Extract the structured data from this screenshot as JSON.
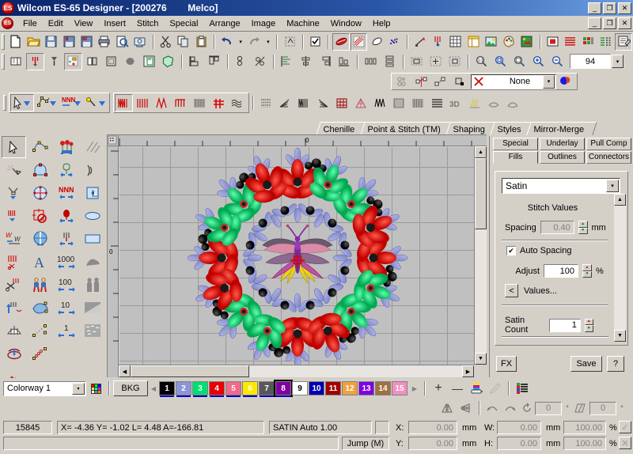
{
  "window": {
    "title": "Wilcom ES-65 Designer - [200276        Melco]",
    "app_icon": "ES",
    "minimize": "_",
    "maximize": "❐",
    "close": "✕"
  },
  "menu": {
    "items": [
      "File",
      "Edit",
      "View",
      "Insert",
      "Stitch",
      "Special",
      "Arrange",
      "Image",
      "Machine",
      "Window",
      "Help"
    ],
    "doc_minimize": "_",
    "doc_maximize": "❐",
    "doc_close": "✕"
  },
  "toolbars": {
    "standard": [
      {
        "name": "new-icon",
        "glyph": "📄"
      },
      {
        "name": "open-icon",
        "glyph": "📂"
      },
      {
        "name": "save-icon",
        "glyph": "💾"
      },
      {
        "name": "save-stitch-icon",
        "glyph": "🖫"
      },
      {
        "name": "save-machine-icon",
        "glyph": "🖬"
      },
      {
        "name": "print-icon",
        "glyph": "🖨"
      },
      {
        "name": "print-preview-icon",
        "glyph": "🔎"
      },
      {
        "name": "send-to-machine-icon",
        "glyph": "🖳"
      },
      {
        "name": "cut-icon",
        "glyph": "✂"
      },
      {
        "name": "copy-icon",
        "glyph": "⧉"
      },
      {
        "name": "paste-icon",
        "glyph": "📋"
      },
      {
        "name": "undo-icon",
        "glyph": "↩"
      },
      {
        "name": "undo-dropdown-icon",
        "glyph": "▾"
      },
      {
        "name": "redo-icon",
        "glyph": "↪"
      },
      {
        "name": "redo-dropdown-icon",
        "glyph": "▾"
      },
      {
        "name": "reshape-icon",
        "glyph": "⌗"
      },
      {
        "name": "select-check-icon",
        "glyph": "☑"
      },
      {
        "name": "stitch-view-icon",
        "glyph": "🌶"
      },
      {
        "name": "needle-points-icon",
        "glyph": "▧"
      },
      {
        "name": "outline-view-icon",
        "glyph": "◌"
      },
      {
        "name": "connectors-view-icon",
        "glyph": "⁘"
      },
      {
        "name": "measure-icon",
        "glyph": "⤢"
      },
      {
        "name": "stitch-player-icon",
        "glyph": "⇟"
      },
      {
        "name": "grid-icon",
        "glyph": "▦"
      },
      {
        "name": "hoop-icon",
        "glyph": "▤"
      },
      {
        "name": "backdrop-icon",
        "glyph": "🏞"
      },
      {
        "name": "color-palette-icon",
        "glyph": "🎨"
      },
      {
        "name": "bitmap-icon",
        "glyph": "🖼"
      },
      {
        "name": "thumbnail-icon",
        "glyph": "▣"
      },
      {
        "name": "stitch-list-icon",
        "glyph": "≣"
      },
      {
        "name": "color-film-icon",
        "glyph": "▥"
      },
      {
        "name": "object-props-icon",
        "glyph": "▩"
      },
      {
        "name": "design-props-icon",
        "glyph": "🗒"
      }
    ],
    "view_row": [
      {
        "name": "align-left-icon",
        "glyph": "⫞"
      },
      {
        "name": "align-center-icon",
        "glyph": "⫟"
      },
      {
        "name": "align-right-icon",
        "glyph": "⫠"
      },
      {
        "name": "distribute-h-icon",
        "glyph": "⫝"
      },
      {
        "name": "distribute-v-icon",
        "glyph": "⩸"
      },
      {
        "name": "group-icon",
        "glyph": "⊞"
      },
      {
        "name": "ungroup-icon",
        "glyph": "⊟"
      },
      {
        "name": "lock-icon",
        "glyph": "⊠"
      },
      {
        "name": "zoom-11-icon",
        "glyph": "🔍"
      },
      {
        "name": "zoom-in-box-icon",
        "glyph": "🔍"
      },
      {
        "name": "zoom-to-fit-icon",
        "glyph": "🔍"
      },
      {
        "name": "zoom-in-icon",
        "glyph": "🔍"
      },
      {
        "name": "zoom-out-icon",
        "glyph": "🔍"
      }
    ],
    "zoom_value": "94",
    "zoom_dropdown": "▾"
  },
  "connector_bar": {
    "icons": [
      {
        "name": "auto-start-end-icon",
        "glyph": "◌"
      },
      {
        "name": "connector-type-icon",
        "glyph": "◈"
      },
      {
        "name": "entry-point-icon",
        "glyph": "◇"
      },
      {
        "name": "exit-point-icon",
        "glyph": "◆"
      }
    ],
    "selected_value": "None",
    "dropdown_glyph": "▾",
    "color_icon": "color-wheel-icon"
  },
  "mode_bar": {
    "left_groups": [
      {
        "name": "select-object-icon",
        "glyph": "➤",
        "dropdown": true
      },
      {
        "name": "reshape-object-icon",
        "glyph": "⬡",
        "dropdown": true
      },
      {
        "name": "stitch-edit-icon",
        "glyph": "NNN",
        "dropdown": true
      },
      {
        "name": "digitize-icon",
        "glyph": "✎",
        "dropdown": true
      }
    ],
    "stitch_types": [
      {
        "name": "satin-stitch-icon",
        "glyph": "ΜΜ"
      },
      {
        "name": "step-stitch-icon",
        "glyph": "ΙΙΙ"
      },
      {
        "name": "zigzag-stitch-icon",
        "glyph": "ΛΛ"
      },
      {
        "name": "e-stitch-icon",
        "glyph": "ΠΠ"
      },
      {
        "name": "tatami-fill-icon",
        "glyph": "▦"
      },
      {
        "name": "cross-stitch-icon",
        "glyph": "✚"
      },
      {
        "name": "motif-run-icon",
        "glyph": "≋"
      },
      {
        "name": "contour-fill-icon",
        "glyph": "⁞⁞"
      },
      {
        "name": "radial-fill-icon",
        "glyph": "⋙"
      },
      {
        "name": "spiral-fill-icon",
        "glyph": "ΜΜ"
      },
      {
        "name": "florentine-fill-icon",
        "glyph": "⋘"
      },
      {
        "name": "carving-stamp-icon",
        "glyph": "⊞"
      },
      {
        "name": "pattern-stamp-icon",
        "glyph": "◬"
      },
      {
        "name": "jagged-edge-icon",
        "glyph": "ΛΛΛ"
      },
      {
        "name": "stitch-angle-icon",
        "glyph": "▥"
      },
      {
        "name": "auto-fabric-icon",
        "glyph": "▩"
      },
      {
        "name": "underlay-icon",
        "glyph": "≡"
      },
      {
        "name": "3d-warp-icon",
        "glyph": "3D"
      },
      {
        "name": "elastic-lettering-icon",
        "glyph": "✏"
      },
      {
        "name": "arch-normal-icon",
        "glyph": "◡"
      },
      {
        "name": "arch-envelope-icon",
        "glyph": "◠"
      }
    ]
  },
  "doc_tabs": [
    {
      "label": "Chenille"
    },
    {
      "label": "Point & Stitch (TM)"
    },
    {
      "label": "Shaping"
    },
    {
      "label": "Styles"
    },
    {
      "label": "Mirror-Merge"
    }
  ],
  "toolbox": {
    "tools": [
      {
        "name": "select-tool",
        "glyph": "➤",
        "selected": true
      },
      {
        "name": "reshape-node-tool",
        "glyph": "⬡",
        "selected": false
      },
      {
        "name": "motif-fill-tool",
        "glyph": "❀",
        "selected": false
      },
      {
        "name": "slanted-lines-tool",
        "glyph": "⫽",
        "selected": false
      },
      {
        "name": "magic-wand-tool",
        "glyph": "✦",
        "selected": false
      },
      {
        "name": "reshape-arch-tool",
        "glyph": "⌂",
        "selected": false
      },
      {
        "name": "motif-run-tool",
        "glyph": "❁",
        "selected": false
      },
      {
        "name": "arc-tool",
        "glyph": "◠",
        "selected": false
      },
      {
        "name": "stitch-angle-tool",
        "glyph": "⋎",
        "selected": false
      },
      {
        "name": "mirror-merge-tool",
        "glyph": "⊕",
        "selected": false
      },
      {
        "name": "zigzag-tool",
        "glyph": "NNN",
        "selected": false
      },
      {
        "name": "fill-corner-tool",
        "glyph": "◥",
        "selected": false
      },
      {
        "name": "stitch-direction-tool",
        "glyph": "ΜΜ",
        "selected": false
      },
      {
        "name": "remove-overlap-tool",
        "glyph": "⊘",
        "selected": false
      },
      {
        "name": "candlewick-tool",
        "glyph": "◉",
        "selected": false
      },
      {
        "name": "ellipse-tool",
        "glyph": "⬭",
        "selected": false
      },
      {
        "name": "stitch-effects-tool",
        "glyph": "W",
        "selected": false
      },
      {
        "name": "knife-split-tool",
        "glyph": "◍",
        "selected": false
      },
      {
        "name": "tie-in-out-tool",
        "glyph": "⇟",
        "selected": false
      },
      {
        "name": "rectangle-tool",
        "glyph": "▭",
        "selected": false
      },
      {
        "name": "auto-trim-tool",
        "glyph": "✄",
        "selected": false
      },
      {
        "name": "lettering-tool",
        "glyph": "A",
        "selected": false
      },
      {
        "name": "stitch-count-1000-tool",
        "glyph": "1000",
        "selected": false
      },
      {
        "name": "appliqué-tool",
        "glyph": "❧",
        "selected": false
      },
      {
        "name": "trim-tool",
        "glyph": "✁",
        "selected": false
      },
      {
        "name": "clone-tool",
        "glyph": "👥",
        "selected": false
      },
      {
        "name": "stitch-count-100-tool",
        "glyph": "100",
        "selected": false
      },
      {
        "name": "photo-flash-tool",
        "glyph": "👤",
        "selected": false
      },
      {
        "name": "jump-stitch-tool",
        "glyph": "⇡",
        "selected": false
      },
      {
        "name": "freehand-tool",
        "glyph": "🐟",
        "selected": false
      },
      {
        "name": "stitch-count-10-tool",
        "glyph": "10",
        "selected": false
      },
      {
        "name": "gradient-fill-tool",
        "glyph": "◣",
        "selected": false
      },
      {
        "name": "fan-shape-tool",
        "glyph": "⛭",
        "selected": false
      },
      {
        "name": "run-line-tool",
        "glyph": "⋰",
        "selected": false
      },
      {
        "name": "stitch-count-1-tool",
        "glyph": "1",
        "selected": false
      },
      {
        "name": "stipple-fill-tool",
        "glyph": "⁂",
        "selected": false
      },
      {
        "name": "ring-tool",
        "glyph": "◯",
        "selected": false
      },
      {
        "name": "chain-line-tool",
        "glyph": "⁖",
        "selected": false
      },
      {
        "name": "empty-slot-a",
        "glyph": "",
        "selected": false
      },
      {
        "name": "empty-slot-b",
        "glyph": "",
        "selected": false
      },
      {
        "name": "blend-tool",
        "glyph": "◆",
        "selected": false
      },
      {
        "name": "empty-slot-c",
        "glyph": "",
        "selected": false
      },
      {
        "name": "empty-slot-d",
        "glyph": "",
        "selected": false
      },
      {
        "name": "empty-slot-e",
        "glyph": "",
        "selected": false
      }
    ]
  },
  "canvas": {
    "ruler_origin_label": "0",
    "ruler_left_label": "0",
    "scroll_up": "▲",
    "scroll_down": "▼",
    "scroll_left": "◀",
    "scroll_right": "▶"
  },
  "docker": {
    "tabs_row1": [
      {
        "label": "Special",
        "active": false
      },
      {
        "label": "Underlay",
        "active": false
      },
      {
        "label": "Pull Comp",
        "active": false
      }
    ],
    "tabs_row2": [
      {
        "label": "Fills",
        "active": true
      },
      {
        "label": "Outlines",
        "active": false
      },
      {
        "label": "Connectors",
        "active": false
      }
    ],
    "fill_type": "Satin",
    "fill_type_dropdown": "▾",
    "stitch_values_title": "Stitch Values",
    "spacing_label": "Spacing",
    "spacing_value": "0.40",
    "spacing_unit": "mm",
    "auto_spacing_label": "Auto Spacing",
    "auto_spacing_checked": true,
    "auto_spacing_check_glyph": "✔",
    "adjust_label": "Adjust",
    "adjust_value": "100",
    "adjust_unit": "%",
    "values_back_btn": "<",
    "values_label": "Values...",
    "satin_count_label": "Satin Count",
    "satin_count_value": "1",
    "panel_scroll_up": "▲",
    "panel_scroll_down": "▼",
    "fx_button": "FX",
    "save_button": "Save",
    "help_button": "?"
  },
  "colorway_bar": {
    "colorway_value": "Colorway 1",
    "colorway_dropdown": "▾",
    "palette_icon": "palette-grid-icon",
    "bkg_label": "BKG",
    "prev_arrow": "◀",
    "next_arrow": "▶",
    "add_color": "+",
    "remove_color": "—",
    "thread_icon": "thread-spool-icon",
    "pen_icon": "pen-disabled-icon",
    "colorlist_icon": "color-list-icon",
    "colors": [
      {
        "num": "1",
        "hex": "#000000",
        "fg": "#ffffff",
        "selected": false
      },
      {
        "num": "2",
        "hex": "#8c96d6",
        "fg": "#ffffff",
        "selected": false
      },
      {
        "num": "3",
        "hex": "#00e070",
        "fg": "#ffffff",
        "selected": false
      },
      {
        "num": "4",
        "hex": "#e80000",
        "fg": "#ffffff",
        "selected": false
      },
      {
        "num": "5",
        "hex": "#f06a8a",
        "fg": "#ffffff",
        "selected": false
      },
      {
        "num": "6",
        "hex": "#ffe800",
        "fg": "#ffffff",
        "selected": false
      },
      {
        "num": "7",
        "hex": "#585858",
        "fg": "#ffffff",
        "selected": false
      },
      {
        "num": "8",
        "hex": "#8000a0",
        "fg": "#ffffff",
        "selected": true
      },
      {
        "num": "9",
        "hex": "#ffffff",
        "fg": "#000000",
        "selected": false
      },
      {
        "num": "10",
        "hex": "#0000b0",
        "fg": "#ffffff",
        "selected": false
      },
      {
        "num": "11",
        "hex": "#a00000",
        "fg": "#ffffff",
        "selected": false
      },
      {
        "num": "12",
        "hex": "#f0a040",
        "fg": "#ffffff",
        "selected": false
      },
      {
        "num": "13",
        "hex": "#8000e0",
        "fg": "#ffffff",
        "selected": false
      },
      {
        "num": "14",
        "hex": "#a07040",
        "fg": "#ffffff",
        "selected": false
      },
      {
        "num": "15",
        "hex": "#f090c0",
        "fg": "#ffffff",
        "selected": false
      }
    ]
  },
  "transform_bar": {
    "mirror_h_icon": "mirror-horizontal-icon",
    "mirror_v_icon": "mirror-vertical-icon",
    "rotate_ccw_icon": "rotate-ccw-icon",
    "rotate_cw_icon": "rotate-cw-icon",
    "rotate_reset_icon": "rotate-reset-icon",
    "rotate_value": "0",
    "rotate_unit": "°",
    "skew_icon": "skew-icon",
    "skew_value": "0",
    "skew_unit": "°"
  },
  "status_bar": {
    "stitch_count": "15845",
    "coords": "X=  -4.36 Y=  -1.02 L=   4.48 A=-166.81",
    "object_info": "SATIN Auto  1.00",
    "jump_label": "Jump (M)",
    "x_label": "X:",
    "x_value": "0.00",
    "x_unit": "mm",
    "y_label": "Y:",
    "y_value": "0.00",
    "y_unit": "mm",
    "w_label": "W:",
    "w_value": "0.00",
    "w_unit": "mm",
    "w_pct": "100.00",
    "w_pct_unit": "%",
    "h_label": "H:",
    "h_value": "0.00",
    "h_unit": "mm",
    "h_pct": "100.00",
    "h_pct_unit": "%",
    "apply_icon": "✓",
    "cancel_icon": "✕"
  }
}
